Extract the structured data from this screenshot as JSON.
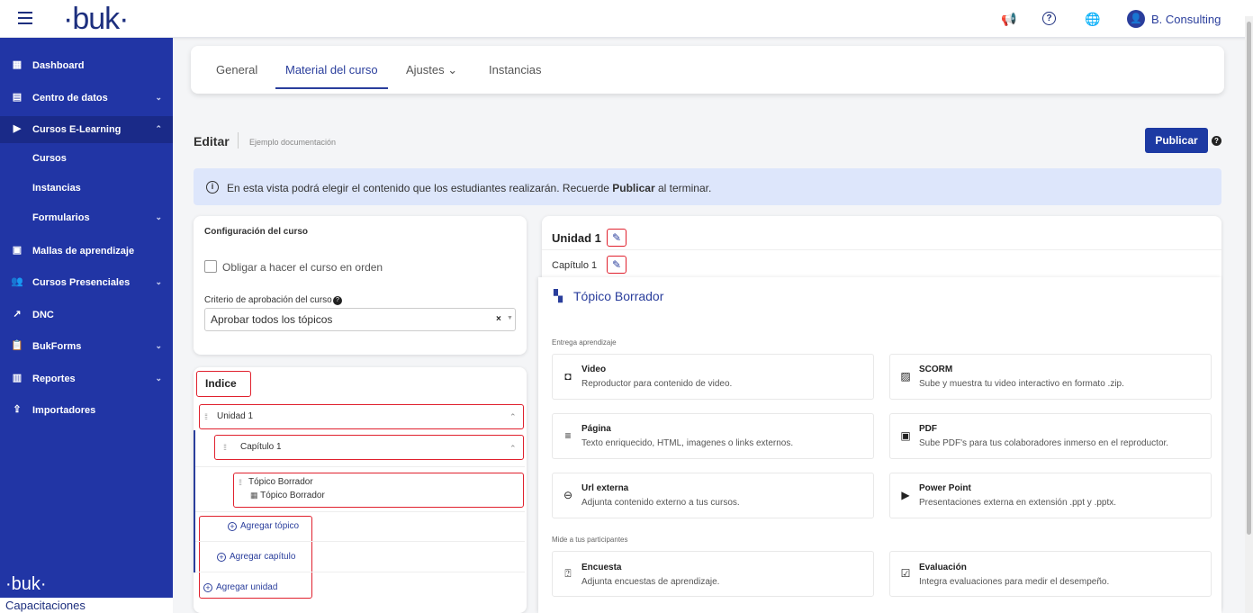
{
  "header": {
    "logo": "·buk·",
    "user": "B. Consulting",
    "avatar_glyph": "👤"
  },
  "sidebar": {
    "items": [
      {
        "label": "Dashboard",
        "icon": "dashboard-icon",
        "glyph": "▦",
        "chev": ""
      },
      {
        "label": "Centro de datos",
        "icon": "server-icon",
        "glyph": "▤",
        "chev": "⌄"
      },
      {
        "label": "Cursos E-Learning",
        "icon": "video-icon",
        "glyph": "▶",
        "chev": "⌃"
      },
      {
        "label": "Mallas de aprendizaje",
        "icon": "book-icon",
        "glyph": "▣",
        "chev": ""
      },
      {
        "label": "Cursos Presenciales",
        "icon": "users-icon",
        "glyph": "👥",
        "chev": "⌄"
      },
      {
        "label": "DNC",
        "icon": "chart-icon",
        "glyph": "↗",
        "chev": ""
      },
      {
        "label": "BukForms",
        "icon": "clipboard-icon",
        "glyph": "📋",
        "chev": "⌄"
      },
      {
        "label": "Reportes",
        "icon": "report-icon",
        "glyph": "▥",
        "chev": "⌄"
      },
      {
        "label": "Importadores",
        "icon": "import-icon",
        "glyph": "⇪",
        "chev": ""
      }
    ],
    "sub": [
      {
        "label": "Cursos"
      },
      {
        "label": "Instancias"
      },
      {
        "label": "Formularios"
      }
    ],
    "footer_logo": "·buk·",
    "footer_text": "Capacitaciones"
  },
  "tabs": [
    "General",
    "Material del curso",
    "Ajustes ⌄",
    "Instancias"
  ],
  "page": {
    "edit": "Editar",
    "subtitle": "Ejemplo documentación",
    "publish": "Publicar"
  },
  "info": {
    "before": "En esta vista podrá elegir el contenido que los estudiantes realizarán. Recuerde ",
    "bold": "Publicar",
    "after": " al terminar."
  },
  "config": {
    "title": "Configuración del curso",
    "checkbox": "Obligar a hacer el curso en orden",
    "criterio": "Criterio de aprobación del curso",
    "select_value": "Aprobar todos los tópicos"
  },
  "index": {
    "title": "Indice",
    "unit": "Unidad 1",
    "chapter": "Capítulo 1",
    "topic": "Tópico Borrador",
    "topic_sub": "Tópico Borrador",
    "add_topic": "Agregar tópico",
    "add_chapter": "Agregar capítulo",
    "add_unit": "Agregar unidad"
  },
  "editor": {
    "unit": "Unidad 1",
    "chapter": "Capítulo 1",
    "topic_title": "Tópico Borrador",
    "sec1": "Entrega aprendizaje",
    "sec2": "Mide a tus participantes",
    "options": [
      {
        "title": "Video",
        "desc": "Reproductor para contenido de video.",
        "icon": "video-camera-icon",
        "glyph": "▭◂"
      },
      {
        "title": "SCORM",
        "desc": "Sube y muestra tu video interactivo en formato .zip.",
        "icon": "scorm-icon",
        "glyph": "▨"
      },
      {
        "title": "Página",
        "desc": "Texto enriquecido, HTML, imagenes o links externos.",
        "icon": "text-icon",
        "glyph": "≡"
      },
      {
        "title": "PDF",
        "desc": "Sube PDF's para tus colaboradores inmerso en el reproductor.",
        "icon": "pdf-icon",
        "glyph": "▣"
      },
      {
        "title": "Url externa",
        "desc": "Adjunta contenido externo a tus cursos.",
        "icon": "link-icon",
        "glyph": "⊖"
      },
      {
        "title": "Power Point",
        "desc": "Presentaciones externa en extensión .ppt y .pptx.",
        "icon": "presentation-icon",
        "glyph": "▶"
      },
      {
        "title": "Encuesta",
        "desc": "Adjunta encuestas de aprendizaje.",
        "icon": "survey-icon",
        "glyph": "❓"
      },
      {
        "title": "Evaluación",
        "desc": "Integra evaluaciones para medir el desempeño.",
        "icon": "evaluation-icon",
        "glyph": "✓"
      }
    ]
  }
}
